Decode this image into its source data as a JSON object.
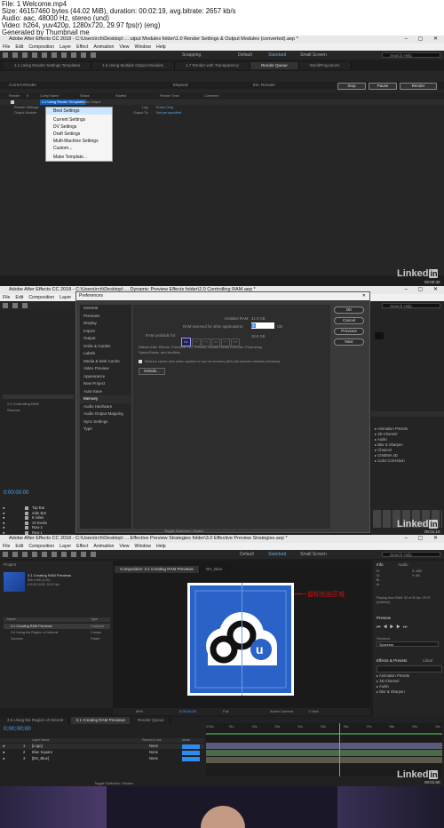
{
  "file_info": {
    "file": "File: 1 Welcome.mp4",
    "size": "Size: 46157460 bytes (44.02 MiB), duration: 00:02:19, avg.bitrate: 2657 kb/s",
    "audio": "Audio: aac, 48000 Hz, stereo (und)",
    "video": "Video: h264, yuv420p, 1280x720, 29.97 fps(r) (eng)",
    "generated": "Generated by Thumbnail me"
  },
  "app": {
    "menus": [
      "File",
      "Edit",
      "Composition",
      "Layer",
      "Effect",
      "Animation",
      "View",
      "Window",
      "Help"
    ],
    "search_placeholder": "Search Help",
    "workspaces": [
      "Default",
      "Standard",
      "Small Screen"
    ],
    "window_controls": "– ▢ ✕"
  },
  "frame1": {
    "title": "Adobe After Effects CC 2018 - C:\\Users\\rch\\Desktop\\ ... utput Modules folder\\1.0 Render Settings & Output Modules (converted).aep *",
    "workspace_extra": "Snapping",
    "tabs": [
      "1.1 Using Render Settings Templates",
      "1.6 Using Multiple Output Modules",
      "1.7 Render with Transparency",
      "Render Queue",
      "WorldProjections"
    ],
    "current_render": "Current Render",
    "elapsed": "Elapsed:",
    "est_remain": "Est. Remain:",
    "columns": [
      "Render",
      "#",
      "Comp Name",
      "Status",
      "Started",
      "Render Time",
      "Comment"
    ],
    "row_comp": "1.1 Using Render Templates",
    "row_status": "Needs Output",
    "render_settings_label": "Render Settings:",
    "output_module_label": "Output Module:",
    "log_label": "Log:",
    "log_value": "Errors Only",
    "output_to_label": "Output To:",
    "output_to_value": "Not yet specified",
    "buttons": [
      "Stop",
      "Pause",
      "Render"
    ],
    "menu_items": [
      "Best Settings",
      "Current Settings",
      "DV Settings",
      "Draft Settings",
      "Multi-Machine Settings",
      "Custom...",
      "Make Template..."
    ],
    "timestamp": "00:00:30"
  },
  "frame2": {
    "title": "Adobe After Effects CC 2018 - C:\\Users\\rch\\Desktop\\ ... Dynamic Preview Effects folder\\2.0 Controlling RAM.aep *",
    "dialog_title": "Preferences",
    "nav": [
      "General",
      "Previews",
      "Display",
      "Import",
      "Output",
      "Grids & Guides",
      "Labels",
      "Media & Disk Cache",
      "Video Preview",
      "Appearance",
      "New Project",
      "Auto-Save",
      "Memory",
      "Audio Hardware",
      "Audio Output Mapping",
      "Sync Settings",
      "Type"
    ],
    "active_nav": "Memory",
    "installed_ram_label": "Installed RAM:",
    "installed_ram_value": "31.9 GB",
    "reserved_label": "RAM reserved for other applications:",
    "reserved_value": "3",
    "reserved_unit": "GB",
    "available_label": "RAM available for:",
    "available_value": "28.9 GB",
    "app_badges": [
      "Ae",
      "Pr",
      "Ps",
      "Au",
      "Pl",
      "Me"
    ],
    "desc": "Affects After Effects, Premiere Pro, Prelude, Adobe Media Encoder, Photoshop, SpeedGrade, and Audition",
    "checkbox_label": "Reduce cache size when system is low on memory (this will shorten cached previews)",
    "details_button": "Details...",
    "buttons": [
      "OK",
      "Cancel",
      "Previous",
      "Next"
    ],
    "project_item": "2.0 Controlling RAM",
    "project_folder": "Sources",
    "timecode": "0:00:00:00",
    "layers": [
      "Top Bar",
      "Side Bar",
      "8 miles",
      "10 tracks",
      "Row 2",
      "Row 1",
      "everest"
    ],
    "effects": [
      "Animation Presets",
      "3D Channel",
      "Audio",
      "Blur & Sharpen",
      "Channel",
      "CINEMA 4D",
      "Color Correction"
    ],
    "toggle_label": "Toggle Switches / Modes",
    "timestamp": "00:01:10"
  },
  "frame3": {
    "title": "Adobe After Effects CC 2018 - C:\\Users\\rch\\Desktop\\ ... Effective Preview Strategies folder\\3.0 Effective Preview Strategies.aep *",
    "project_label": "Project",
    "comp_name": "3.1 Creating RAM Previews",
    "comp_info": [
      "800 x 800 (1.00)",
      "Δ 0;00;10;00, 29.97 fps"
    ],
    "project_items": [
      {
        "name": "3.1 Creating RAM Previews",
        "type": "Composi"
      },
      {
        "name": "3.5 Using the Region of Interest",
        "type": "Compo"
      },
      {
        "name": "Sources",
        "type": "Folder"
      }
    ],
    "project_cols": [
      "Name",
      "Type"
    ],
    "comp_tab": "Composition: 3.1 Creating RAM Previews",
    "layer_tab": "BG_Blue",
    "view_label": "Active Camera",
    "view_layout": "1 View",
    "resolution": "Full",
    "zoom": "66%",
    "time_display": "0;00;04;09",
    "annotation": "一鼠标划出区域",
    "info_tabs": [
      "Info",
      "Audio"
    ],
    "info_values": [
      "R:",
      "G:",
      "B:",
      "A:",
      "X: 832",
      "Y: 69"
    ],
    "preview_label": "Preview",
    "shortcut_label": "Shortcut",
    "shortcut_value": "Spacebar",
    "effects_label": "Effects & Presets",
    "libraries_label": "Librar",
    "effects": [
      "Animation Presets",
      "3D Channel",
      "Audio",
      "Blur & Sharpen"
    ],
    "playing_info": "Playing from RAM: 52 of 92 fps: 29.97 (realtime)",
    "timeline_tabs": [
      "3.5 Using the Region of Interest",
      "3.1 Creating RAM Previews",
      "Render Queue"
    ],
    "timecode": "0;00;00;00",
    "layer_cols": [
      "Layer Name",
      "Parent & Link",
      "Mode"
    ],
    "layers": [
      {
        "num": "1",
        "name": "[Logo]",
        "mode": "None"
      },
      {
        "num": "2",
        "name": "Blue Square",
        "mode": "None"
      },
      {
        "num": "3",
        "name": "[BG_Blue]",
        "mode": "None"
      }
    ],
    "ruler": [
      "0:00s",
      "01s",
      "02s",
      "03s",
      "04s",
      "05s",
      "06s",
      "07s",
      "08s",
      "09s",
      "10s"
    ],
    "toggle_label": "Toggle Switches / Modes",
    "timestamp": "00:01:50"
  },
  "colors": {
    "accent": "#2d8cf0",
    "annotation": "#e01010",
    "logo_bg": "#2a62c8",
    "ae_badge": "#9999ff"
  }
}
